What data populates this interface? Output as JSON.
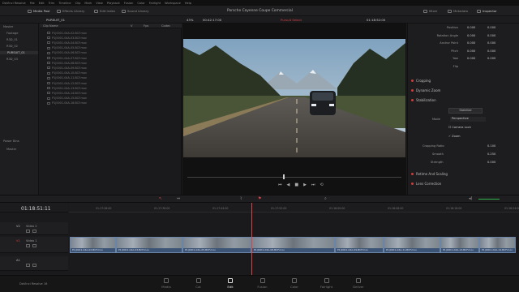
{
  "app": {
    "menu": [
      "DaVinci Resolve",
      "File",
      "Edit",
      "Trim",
      "Timeline",
      "Clip",
      "Mark",
      "View",
      "Playback",
      "Fusion",
      "Color",
      "Fairlight",
      "Workspace",
      "Help"
    ]
  },
  "toolbar": {
    "media_pool": "Media Pool",
    "effects_library": "Effects Library",
    "edit_index": "Edit Index",
    "sound_library": "Sound Library",
    "project_title": "Porsche Cayenne Coupe Commercial",
    "mixer": "Mixer",
    "metadata": "Metadata",
    "inspector": "Inspector"
  },
  "subbar": {
    "bin_path": "PURSUIT_01",
    "zoom": "43%",
    "source_tc": "00:42:17:00",
    "timeline_name": "Pursuit Select",
    "record_tc": "01:18:52:00"
  },
  "bins": {
    "master": "Master",
    "items": [
      "Footage",
      "R3D_01",
      "R3D_02",
      "PURSUIT_01",
      "R3D_03"
    ],
    "selected_index": 3,
    "power_bins": "Power Bins",
    "power_master": "Master"
  },
  "clip_list": {
    "header": {
      "name": "Clip Name",
      "v": "V",
      "fps": "Fps",
      "codec": "Codec"
    },
    "rows": [
      "P1|0001-04A-02-BCF.mov",
      "P1|0001-04A-03-BCF.mov",
      "P1|0001-04A-04-BCF.mov",
      "P1|0001-04A-05-BCF.mov",
      "P1|0001-04A-06-BCF.mov",
      "P1|0001-04A-07-BCF.mov",
      "P1|0001-04A-08-BCF.mov",
      "P1|0001-04A-09-BCF.mov",
      "P1|0001-04A-10-BCF.mov",
      "P1|0001-04A-11-BCF.mov",
      "P1|0001-04A-12-BCF.mov",
      "P1|0001-04A-13-BCF.mov",
      "P1|0001-04A-14-BCF.mov",
      "P1|0001-04A-15-BCF.mov",
      "P1|0001-04A-16-BCF.mov"
    ]
  },
  "inspector": {
    "transform_rows": [
      {
        "label": "Position",
        "x": "0.000",
        "y": "0.000"
      },
      {
        "label": "Rotation Angle",
        "x": "0.000",
        "y": "0.000"
      },
      {
        "label": "Anchor Point",
        "x": "0.000",
        "y": "0.000"
      },
      {
        "label": "Pitch",
        "x": "0.000",
        "y": "0.000"
      },
      {
        "label": "Yaw",
        "x": "0.000",
        "y": "0.000"
      },
      {
        "label": "Flip",
        "x": "",
        "y": ""
      }
    ],
    "cropping": "Cropping",
    "dynamic_zoom": "Dynamic Zoom",
    "stabilization": "Stabilization",
    "stab_button": "Stabilize",
    "mode_label": "Mode",
    "mode_value": "Perspective",
    "camera_lock": "Camera Lock",
    "zoom_check": "Zoom",
    "cropping_ratio_label": "Cropping Ratio",
    "cropping_ratio": "0.100",
    "smooth_label": "Smooth",
    "smooth": "0.250",
    "strength_label": "Strength",
    "strength": "0.000",
    "retime": "Retime And Scaling",
    "lens": "Lens Correction"
  },
  "timeline": {
    "timecode": "01:18:51:11",
    "ruler": [
      "01:17:28:00",
      "01:17:36:00",
      "01:17:44:00",
      "01:17:52:00",
      "01:18:00:00",
      "01:18:08:00",
      "01:18:16:00",
      "01:18:24:00"
    ],
    "tracks": [
      {
        "id": "V2",
        "name": "Video 2"
      },
      {
        "id": "V1",
        "name": "Video 1"
      },
      {
        "id": "A1",
        "name": ""
      }
    ],
    "clips": [
      {
        "label": "P1|0001-04A-02-BCF.mov"
      },
      {
        "label": "P1|0001-04A-03-BCF.mov"
      },
      {
        "label": "P1|0001-04A-05-BCF.mov"
      },
      {
        "label": "P1|0001-04A-08-BCF.mov"
      },
      {
        "label": "P1|0001-04A-09-BCF.mov"
      },
      {
        "label": "P1|0001-04A-11-BCF.mov"
      },
      {
        "label": "P1|0001-04A-13-BCF.mov"
      },
      {
        "label": "P1|0001-04A-14-BCF.mov"
      }
    ]
  },
  "pages": [
    "Media",
    "Cut",
    "Edit",
    "Fusion",
    "Color",
    "Fairlight",
    "Deliver"
  ],
  "active_page": "Edit",
  "footer": {
    "app_name": "DaVinci Resolve 16"
  }
}
